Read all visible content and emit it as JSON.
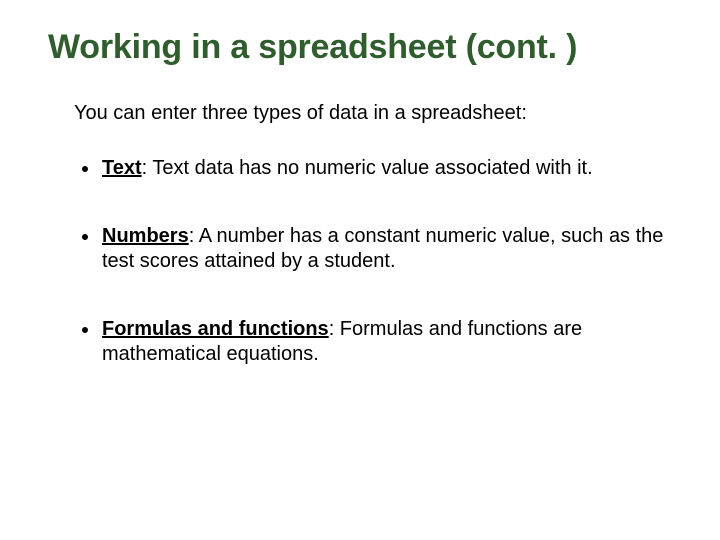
{
  "title": "Working in a spreadsheet (cont. )",
  "intro": "You can enter three types of data in a spreadsheet:",
  "bullets": [
    {
      "term": "Text",
      "rest": ": Text data has no numeric value associated with it."
    },
    {
      "term": "Numbers",
      "rest": ": A number has a constant numeric value, such as the test scores attained by a student."
    },
    {
      "term": "Formulas and functions",
      "rest": ": Formulas and functions are mathematical equations."
    }
  ]
}
